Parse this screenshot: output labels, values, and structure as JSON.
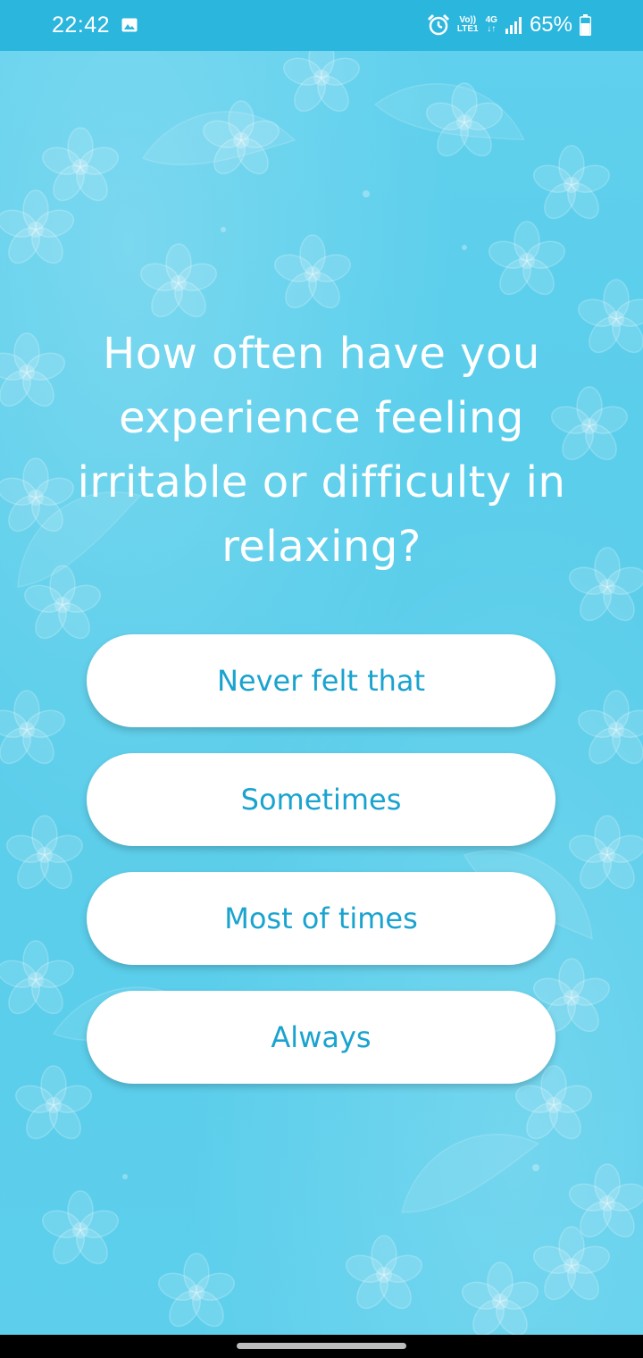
{
  "status_bar": {
    "time": "22:42",
    "volte_top": "Vo))",
    "volte_bottom": "LTE1",
    "network": "4G",
    "battery": "65%",
    "icons": [
      "gallery-icon",
      "alarm-icon",
      "volte-icon",
      "network-4g-icon",
      "signal-icon",
      "battery-icon"
    ]
  },
  "question": {
    "text": "How often have you experience feeling irritable or difficulty in relaxing?"
  },
  "options": [
    {
      "label": "Never felt that"
    },
    {
      "label": "Sometimes"
    },
    {
      "label": "Most of times"
    },
    {
      "label": "Always"
    }
  ],
  "colors": {
    "status_bar": "#2bb6de",
    "background": "#5ccfec",
    "option_text": "#1aa3cf",
    "option_bg": "#ffffff"
  }
}
